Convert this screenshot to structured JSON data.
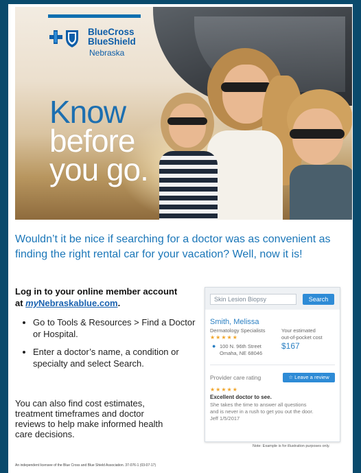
{
  "brand": {
    "name_line1": "BlueCross",
    "name_line2": "BlueShield",
    "state": "Nebraska",
    "primary_color": "#0e5ea8"
  },
  "hero": {
    "tagline_line1": "Know",
    "tagline_line2": "before",
    "tagline_line3": "you go."
  },
  "headline": "Wouldn’t it be nice if searching for a doctor was as convenient as finding the right rental car for your vacation? Well, now it is!",
  "login": {
    "prefix": "Log in to your online member account at ",
    "link_my": "my",
    "link_rest": "Nebraskablue.com",
    "suffix": "."
  },
  "bullets": [
    "Go to Tools & Resources > Find a Doctor or Hospital.",
    "Enter a doctor’s name, a condition or specialty and select Search."
  ],
  "cost_text": "You can also find cost estimates, treatment timeframes and doctor reviews to help make informed health care decisions.",
  "mockup": {
    "search_value": "Skin Lesion Biopsy",
    "search_button": "Search",
    "doctor_name": "Smith, Melissa",
    "specialty": "Dermatology Specialists",
    "stars": "★★★★★",
    "address_line1": "100 N. 96th Street",
    "address_line2": "Omaha, NE 68046",
    "estimate_line1": "Your estimated",
    "estimate_line2": "out-of-pocket cost",
    "price": "$167",
    "rating_label": "Provider care rating",
    "review_button": "☆ Leave a review",
    "review_title": "Excellent doctor to see.",
    "review_body1": "She takes the time to answer all questions",
    "review_body2": "and is never in a rush to get you out the door.",
    "review_signature": "Jeff 1/5/2017",
    "accent_color": "#2e8bd6"
  },
  "note": "Note: Example is for illustration purposes only.",
  "footer": "An independent licensee of the Blue Cross and Blue Shield Association.   37-076-1 (03-07-17)"
}
